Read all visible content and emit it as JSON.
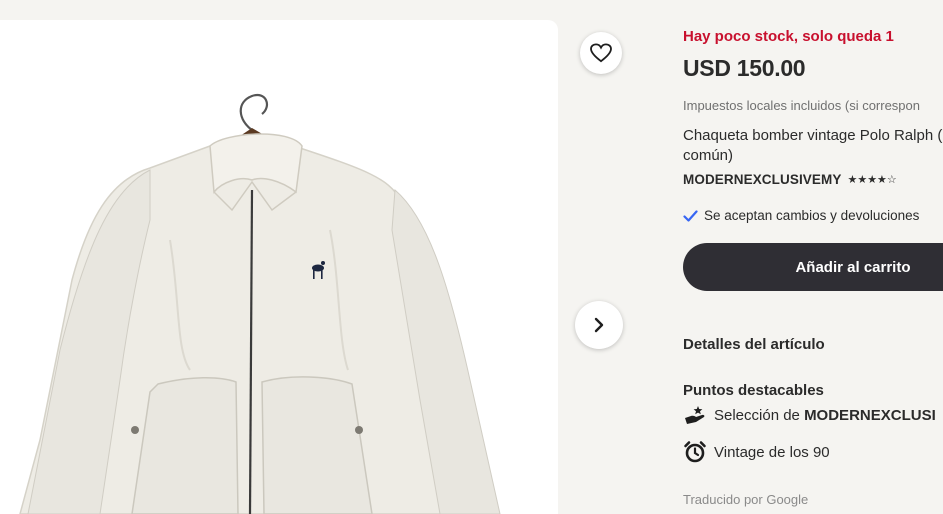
{
  "listing": {
    "stock_notice": "Hay poco stock, solo queda 1",
    "price": "USD 150.00",
    "tax_note": "Impuestos locales incluidos (si correspon",
    "title": "Chaqueta bomber vintage Polo Ralph (poco común)",
    "seller": {
      "name": "MODERNEXCLUSIVEMY",
      "rating_stars": "★★★★☆",
      "rating_value": 3.5
    },
    "returns": "Se aceptan cambios y devoluciones",
    "add_to_cart": "Añadir al carrito",
    "details_heading": "Detalles del artículo",
    "highlights_heading": "Puntos destacables",
    "highlights": [
      {
        "prefix": "Selección de ",
        "strong": "MODERNEXCLUSI",
        "icon": "hand-star-icon"
      },
      {
        "prefix": "Vintage de los 90",
        "strong": "",
        "icon": "alarm-clock-icon"
      }
    ],
    "translated_by": "Traducido por Google"
  },
  "colors": {
    "stock_red": "#c8102e",
    "cart_bg": "#2f2e34",
    "check_blue": "#3665f3",
    "page_bg": "#f5f4f1"
  }
}
